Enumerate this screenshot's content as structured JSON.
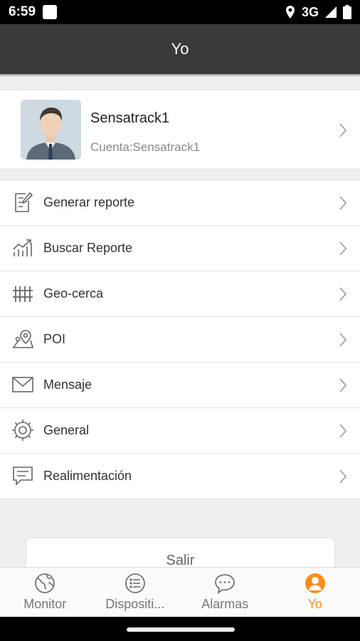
{
  "status_bar": {
    "time": "6:59",
    "network": "3G"
  },
  "header": {
    "title": "Yo"
  },
  "profile": {
    "name": "Sensatrack1",
    "account": "Cuenta:Sensatrack1"
  },
  "menu": {
    "items": [
      {
        "label": "Generar reporte",
        "icon": "report-edit-icon"
      },
      {
        "label": "Buscar Reporte",
        "icon": "trend-chart-icon"
      },
      {
        "label": "Geo-cerca",
        "icon": "fence-icon"
      },
      {
        "label": "POI",
        "icon": "map-pin-icon"
      },
      {
        "label": "Mensaje",
        "icon": "envelope-icon"
      },
      {
        "label": "General",
        "icon": "gear-icon"
      },
      {
        "label": "Realimentación",
        "icon": "feedback-icon"
      }
    ]
  },
  "logout": {
    "label": "Salir"
  },
  "tabs": [
    {
      "label": "Monitor",
      "icon": "globe-icon",
      "active": false
    },
    {
      "label": "Dispositi...",
      "icon": "list-icon",
      "active": false
    },
    {
      "label": "Alarmas",
      "icon": "chat-bubble-icon",
      "active": false
    },
    {
      "label": "Yo",
      "icon": "person-icon",
      "active": true
    }
  ],
  "colors": {
    "header_bg": "#3a3a3a",
    "accent": "#ff8c1a",
    "icon_gray": "#666666"
  }
}
